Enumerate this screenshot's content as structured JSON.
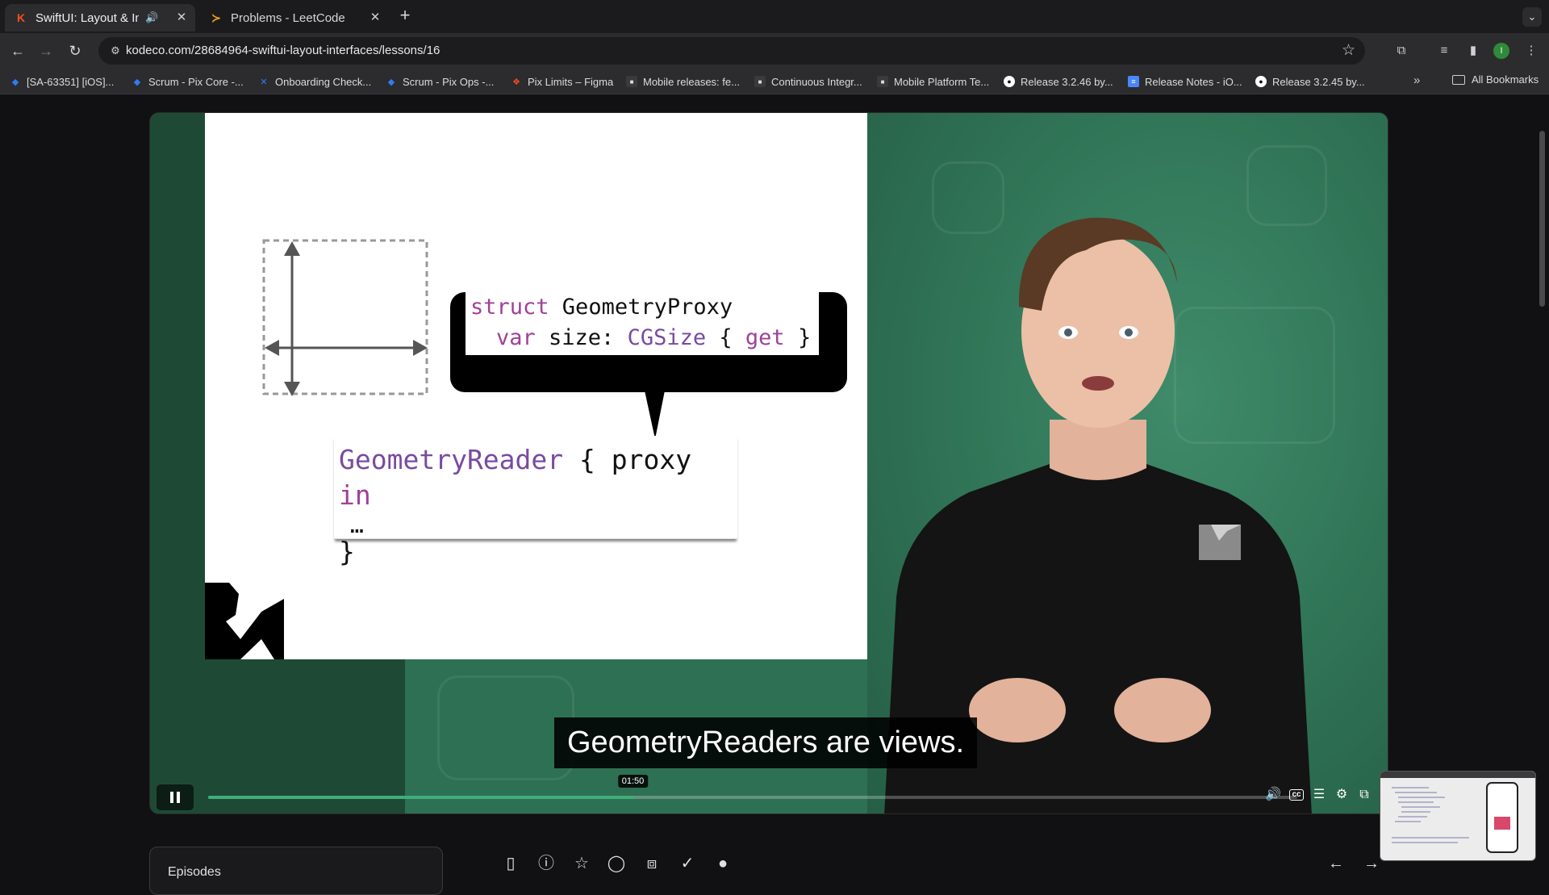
{
  "browser": {
    "tabs": [
      {
        "title": "SwiftUI: Layout & Interfac",
        "favicon": "K",
        "active": true
      },
      {
        "title": "Problems - LeetCode",
        "favicon": "leetcode-icon",
        "active": false
      }
    ],
    "url": "kodeco.com/28684964-swiftui-layout-interfaces/lessons/16",
    "profile_initial": "I",
    "bookmarks": [
      {
        "label": "[SA-63351] [iOS]...",
        "icon": "jira-icon",
        "color": "#2f7cf6"
      },
      {
        "label": "Scrum - Pix Core -...",
        "icon": "jira-icon",
        "color": "#2f7cf6"
      },
      {
        "label": "Onboarding Check...",
        "icon": "confluence-icon",
        "color": "#2f7cf6"
      },
      {
        "label": "Scrum - Pix Ops -...",
        "icon": "jira-icon",
        "color": "#2f7cf6"
      },
      {
        "label": "Pix Limits – Figma",
        "icon": "figma-icon",
        "color": "#f24e1e"
      },
      {
        "label": "Mobile releases: fe...",
        "icon": "pix-icon",
        "color": "#555555"
      },
      {
        "label": "Continuous Integr...",
        "icon": "pix-icon",
        "color": "#555555"
      },
      {
        "label": "Mobile Platform Te...",
        "icon": "pix-icon",
        "color": "#555555"
      },
      {
        "label": "Release 3.2.46 by...",
        "icon": "github-icon",
        "color": "#ffffff"
      },
      {
        "label": "Release Notes - iO...",
        "icon": "docs-icon",
        "color": "#4a86f7"
      },
      {
        "label": "Release 3.2.45 by...",
        "icon": "github-icon",
        "color": "#ffffff"
      }
    ],
    "all_bookmarks_label": "All Bookmarks",
    "more_bookmarks": "»"
  },
  "video": {
    "slide": {
      "proxy_code_line1_kw": "struct",
      "proxy_code_line1_name": " GeometryProxy",
      "proxy_code_line2_kw": "var",
      "proxy_code_line2_mid": " size: ",
      "proxy_code_line2_type": "CGSize",
      "proxy_code_line2_open": " { ",
      "proxy_code_line2_get": "get",
      "proxy_code_line2_close": " }",
      "reader_type": "GeometryReader",
      "reader_mid": " { proxy ",
      "reader_in": "in",
      "reader_ellipsis": "…",
      "reader_close": "}"
    },
    "caption": "GeometryReaders are views.",
    "current_time": "01:50",
    "progress": 0.39,
    "colors": {
      "accent": "#3fae7a",
      "keyword": "#a0409a"
    }
  },
  "below": {
    "episode_label": "Episodes"
  }
}
